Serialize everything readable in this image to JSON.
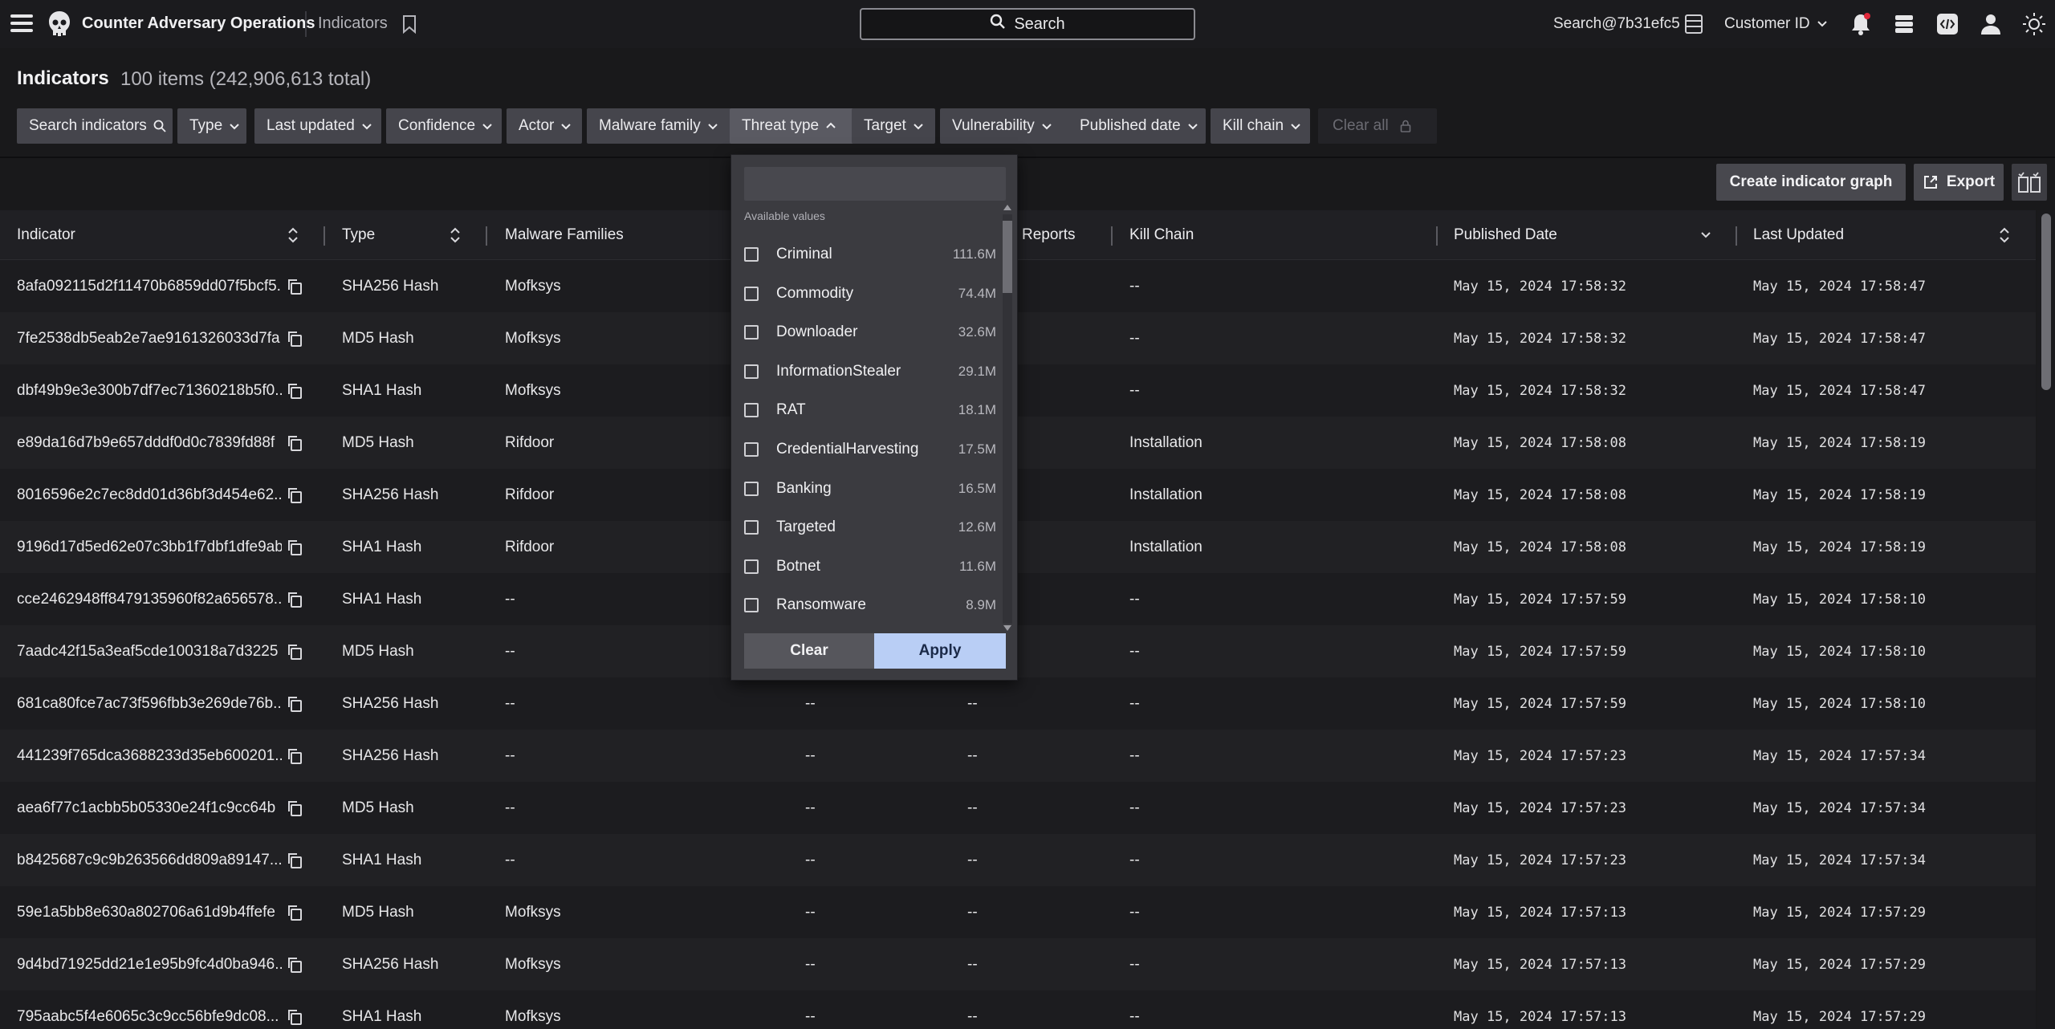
{
  "topbar": {
    "app_title": "Counter Adversary Operations",
    "breadcrumb": "Indicators",
    "search_label": "Search",
    "search_user": "Search@7b31efc5",
    "customer_label": "Customer ID"
  },
  "page": {
    "title": "Indicators",
    "count": "100 items (242,906,613 total)"
  },
  "filters": {
    "search_label": "Search indicators",
    "chips": [
      "Type",
      "Last updated",
      "Confidence",
      "Actor",
      "Malware family",
      "Threat type",
      "Target",
      "Vulnerability",
      "Published date",
      "Kill chain"
    ],
    "active_chip": "Threat type",
    "clear_all": "Clear all"
  },
  "actions": {
    "create_graph": "Create indicator graph",
    "export": "Export"
  },
  "table": {
    "columns": [
      "Indicator",
      "Type",
      "Malware Families",
      "Reports",
      "Kill Chain",
      "Published Date",
      "Last Updated"
    ],
    "rows": [
      {
        "indicator": "8afa092115d2f11470b6859dd07f5bcf5...",
        "type": "SHA256 Hash",
        "malware": "Mofksys",
        "actors": "",
        "reports": "",
        "kill_chain": "--",
        "published": "May 15, 2024 17:58:32",
        "updated": "May 15, 2024 17:58:47"
      },
      {
        "indicator": "7fe2538db5eab2e7ae9161326033d7fa",
        "type": "MD5 Hash",
        "malware": "Mofksys",
        "actors": "",
        "reports": "",
        "kill_chain": "--",
        "published": "May 15, 2024 17:58:32",
        "updated": "May 15, 2024 17:58:47"
      },
      {
        "indicator": "dbf49b9e3e300b7df7ec71360218b5f0...",
        "type": "SHA1 Hash",
        "malware": "Mofksys",
        "actors": "",
        "reports": "",
        "kill_chain": "--",
        "published": "May 15, 2024 17:58:32",
        "updated": "May 15, 2024 17:58:47"
      },
      {
        "indicator": "e89da16d7b9e657dddf0d0c7839fd88f",
        "type": "MD5 Hash",
        "malware": "Rifdoor",
        "actors": "",
        "reports": "",
        "kill_chain": "Installation",
        "published": "May 15, 2024 17:58:08",
        "updated": "May 15, 2024 17:58:19"
      },
      {
        "indicator": "8016596e2c7ec8dd01d36bf3d454e62...",
        "type": "SHA256 Hash",
        "malware": "Rifdoor",
        "actors": "",
        "reports": "",
        "kill_chain": "Installation",
        "published": "May 15, 2024 17:58:08",
        "updated": "May 15, 2024 17:58:19"
      },
      {
        "indicator": "9196d17d5ed62e07c3bb1f7dbf1dfe9ab...",
        "type": "SHA1 Hash",
        "malware": "Rifdoor",
        "actors": "",
        "reports": "",
        "kill_chain": "Installation",
        "published": "May 15, 2024 17:58:08",
        "updated": "May 15, 2024 17:58:19"
      },
      {
        "indicator": "cce2462948ff8479135960f82a656578...",
        "type": "SHA1 Hash",
        "malware": "--",
        "actors": "",
        "reports": "",
        "kill_chain": "--",
        "published": "May 15, 2024 17:57:59",
        "updated": "May 15, 2024 17:58:10"
      },
      {
        "indicator": "7aadc42f15a3eaf5cde100318a7d3225",
        "type": "MD5 Hash",
        "malware": "--",
        "actors": "",
        "reports": "",
        "kill_chain": "--",
        "published": "May 15, 2024 17:57:59",
        "updated": "May 15, 2024 17:58:10"
      },
      {
        "indicator": "681ca80fce7ac73f596fbb3e269de76b...",
        "type": "SHA256 Hash",
        "malware": "--",
        "actors": "--",
        "reports": "--",
        "kill_chain": "--",
        "published": "May 15, 2024 17:57:59",
        "updated": "May 15, 2024 17:58:10"
      },
      {
        "indicator": "441239f765dca3688233d35eb600201...",
        "type": "SHA256 Hash",
        "malware": "--",
        "actors": "--",
        "reports": "--",
        "kill_chain": "--",
        "published": "May 15, 2024 17:57:23",
        "updated": "May 15, 2024 17:57:34"
      },
      {
        "indicator": "aea6f77c1acbb5b05330e24f1c9cc64b",
        "type": "MD5 Hash",
        "malware": "--",
        "actors": "--",
        "reports": "--",
        "kill_chain": "--",
        "published": "May 15, 2024 17:57:23",
        "updated": "May 15, 2024 17:57:34"
      },
      {
        "indicator": "b8425687c9c9b263566dd809a89147...",
        "type": "SHA1 Hash",
        "malware": "--",
        "actors": "--",
        "reports": "--",
        "kill_chain": "--",
        "published": "May 15, 2024 17:57:23",
        "updated": "May 15, 2024 17:57:34"
      },
      {
        "indicator": "59e1a5bb8e630a802706a61d9b4ffefe",
        "type": "MD5 Hash",
        "malware": "Mofksys",
        "actors": "--",
        "reports": "--",
        "kill_chain": "--",
        "published": "May 15, 2024 17:57:13",
        "updated": "May 15, 2024 17:57:29"
      },
      {
        "indicator": "9d4bd71925dd21e1e95b9fc4d0ba946...",
        "type": "SHA256 Hash",
        "malware": "Mofksys",
        "actors": "--",
        "reports": "--",
        "kill_chain": "--",
        "published": "May 15, 2024 17:57:13",
        "updated": "May 15, 2024 17:57:29"
      },
      {
        "indicator": "795aabc5f4e6065c3c9cc56bfe9dc08...",
        "type": "SHA1 Hash",
        "malware": "Mofksys",
        "actors": "--",
        "reports": "--",
        "kill_chain": "--",
        "published": "May 15, 2024 17:57:13",
        "updated": "May 15, 2024 17:57:29"
      }
    ]
  },
  "dropdown": {
    "search_value": "",
    "available_label": "Available values",
    "options": [
      {
        "name": "Criminal",
        "count": "111.6M"
      },
      {
        "name": "Commodity",
        "count": "74.4M"
      },
      {
        "name": "Downloader",
        "count": "32.6M"
      },
      {
        "name": "InformationStealer",
        "count": "29.1M"
      },
      {
        "name": "RAT",
        "count": "18.1M"
      },
      {
        "name": "CredentialHarvesting",
        "count": "17.5M"
      },
      {
        "name": "Banking",
        "count": "16.5M"
      },
      {
        "name": "Targeted",
        "count": "12.6M"
      },
      {
        "name": "Botnet",
        "count": "11.6M"
      },
      {
        "name": "Ransomware",
        "count": "8.9M"
      }
    ],
    "clear_label": "Clear",
    "apply_label": "Apply"
  },
  "colors": {
    "background": "#19191b",
    "apply_button": "#b9cef5",
    "notification_dot": "#e0293b"
  }
}
